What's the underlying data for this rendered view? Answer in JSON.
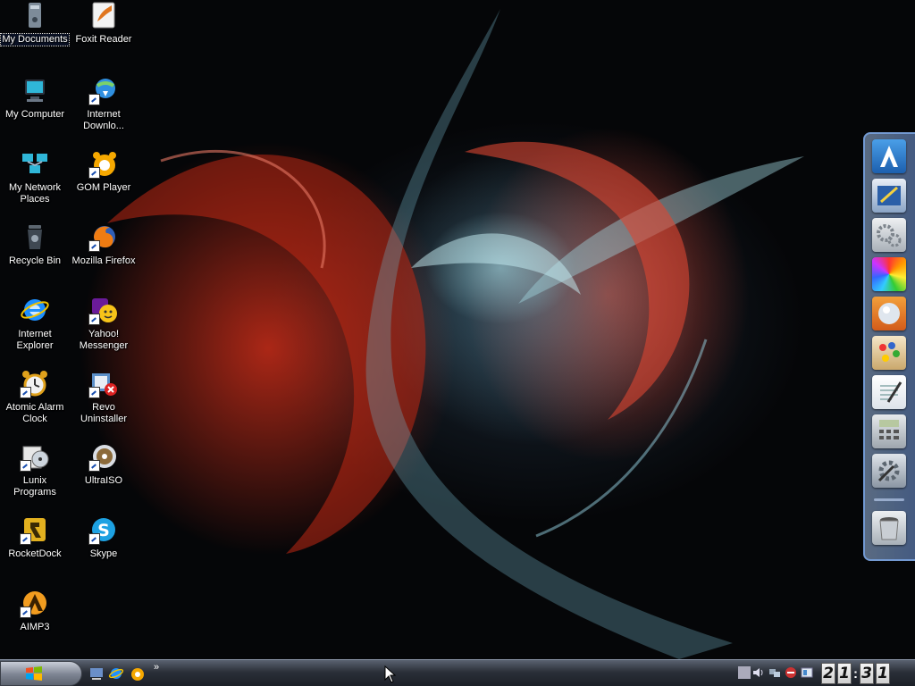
{
  "desktop": {
    "icons": [
      {
        "label": "My Documents",
        "icon": "my-documents-icon"
      },
      {
        "label": "Foxit Reader",
        "icon": "foxit-reader-icon"
      },
      {
        "label": "My Computer",
        "icon": "my-computer-icon"
      },
      {
        "label": "Internet Downlo...",
        "icon": "internet-download-manager-icon"
      },
      {
        "label": "My Network Places",
        "icon": "my-network-places-icon"
      },
      {
        "label": "GOM Player",
        "icon": "gom-player-icon"
      },
      {
        "label": "Recycle Bin",
        "icon": "recycle-bin-icon"
      },
      {
        "label": "Mozilla Firefox",
        "icon": "firefox-icon"
      },
      {
        "label": "Internet Explorer",
        "icon": "internet-explorer-icon"
      },
      {
        "label": "Yahoo! Messenger",
        "icon": "yahoo-messenger-icon"
      },
      {
        "label": "Atomic Alarm Clock",
        "icon": "alarm-clock-icon"
      },
      {
        "label": "Revo Uninstaller",
        "icon": "revo-uninstaller-icon"
      },
      {
        "label": "Lunix Programs",
        "icon": "lunix-programs-icon"
      },
      {
        "label": "UltraISO",
        "icon": "ultraiso-icon"
      },
      {
        "label": "RocketDock",
        "icon": "rocketdock-icon"
      },
      {
        "label": "Skype",
        "icon": "skype-icon"
      },
      {
        "label": "AIMP3",
        "icon": "aimp3-icon"
      }
    ]
  },
  "dock": {
    "items": [
      "dock-a-icon",
      "dock-paint-icon",
      "dock-gears-icon",
      "dock-color-wheel-icon",
      "dock-globe-icon",
      "dock-palette-icon",
      "dock-notepad-icon",
      "dock-calculator-icon",
      "dock-settings-icon",
      "dock-trash-icon"
    ]
  },
  "taskbar": {
    "quick_launch": [
      "show-desktop-icon",
      "internet-explorer-icon",
      "messenger-icon"
    ],
    "chevron": "»",
    "clock": {
      "h1": "2",
      "h2": "1",
      "sep": ":",
      "m1": "3",
      "m2": "1"
    }
  },
  "colors": {
    "taskbar": "#2a2f38",
    "dock_border": "#78a0dc"
  }
}
